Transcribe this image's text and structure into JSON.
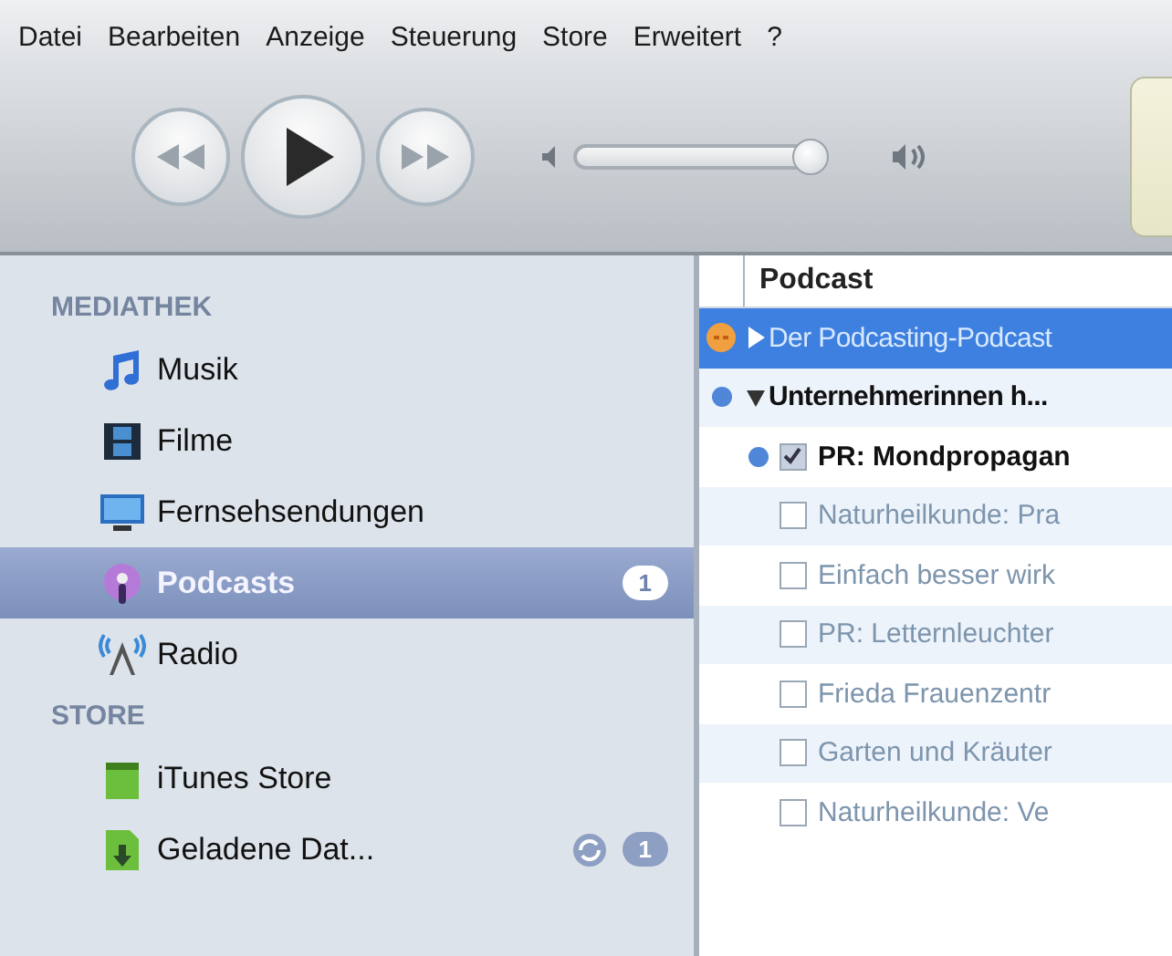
{
  "menu": [
    "Datei",
    "Bearbeiten",
    "Anzeige",
    "Steuerung",
    "Store",
    "Erweitert",
    "?"
  ],
  "player": {
    "volume": {
      "level": 0.95
    }
  },
  "sidebar": {
    "sections": [
      {
        "title": "MEDIATHEK",
        "items": [
          {
            "label": "Musik",
            "selected": false
          },
          {
            "label": "Filme",
            "selected": false
          },
          {
            "label": "Fernsehsendungen",
            "selected": false
          },
          {
            "label": "Podcasts",
            "selected": true,
            "badge": "1"
          },
          {
            "label": "Radio",
            "selected": false
          }
        ]
      },
      {
        "title": "STORE",
        "items": [
          {
            "label": "iTunes Store",
            "selected": false
          },
          {
            "label": "Geladene Dat...",
            "selected": false,
            "syncing": true,
            "badge": "1"
          }
        ]
      }
    ]
  },
  "list": {
    "column": "Podcast",
    "rows": [
      {
        "title": "Der Podcasting-Podcast",
        "selected": true,
        "expanded": false,
        "updating": true
      },
      {
        "title": "Unternehmerinnen h...",
        "selected": false,
        "expanded": true,
        "unplayed": true,
        "children": [
          {
            "title": "PR: Mondpropagan",
            "checked": true,
            "unplayed": true
          },
          {
            "title": "Naturheilkunde: Pra",
            "checked": false,
            "unplayed": false
          },
          {
            "title": "Einfach besser wirk",
            "checked": false,
            "unplayed": false
          },
          {
            "title": "PR: Letternleuchter",
            "checked": false,
            "unplayed": false
          },
          {
            "title": "Frieda Frauenzentr",
            "checked": false,
            "unplayed": false
          },
          {
            "title": "Garten und Kräuter",
            "checked": false,
            "unplayed": false
          },
          {
            "title": "Naturheilkunde: Ve",
            "checked": false,
            "unplayed": false
          }
        ]
      }
    ]
  }
}
